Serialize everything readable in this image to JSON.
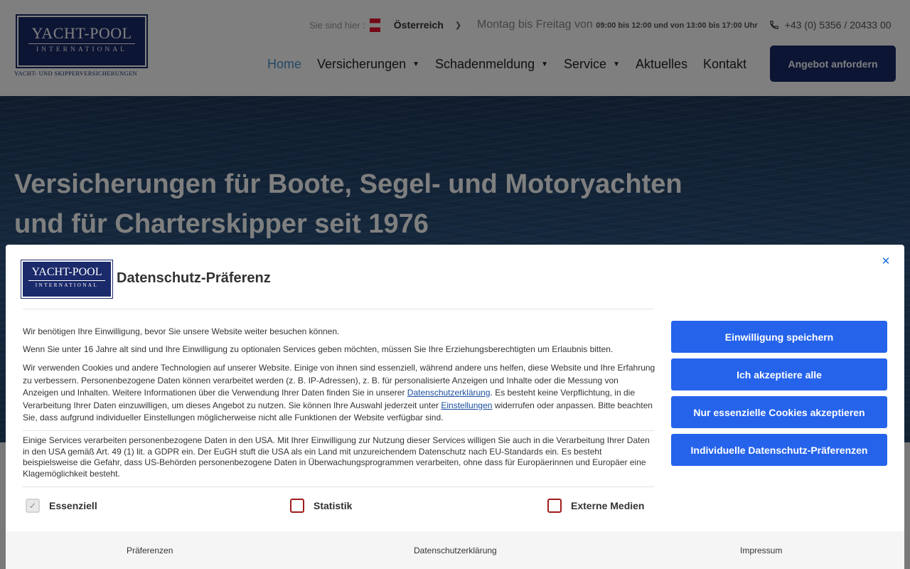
{
  "header": {
    "logo": {
      "main": "YACHT-POOL",
      "sub": "INTERNATIONAL",
      "tagline": "YACHT- UND SKIPPERVERSICHERUNGEN"
    },
    "location_label": "Sie sind hier :",
    "country": "Österreich",
    "hours_prefix": "Montag bis Freitag von",
    "hours_detail": "09:00 bis 12:00 und von 13:00 bis 17:00 Uhr",
    "phone": "+43 (0) 5356 / 20433 00",
    "nav": [
      {
        "label": "Home",
        "active": true,
        "dropdown": false
      },
      {
        "label": "Versicherungen",
        "active": false,
        "dropdown": true
      },
      {
        "label": "Schadenmeldung",
        "active": false,
        "dropdown": true
      },
      {
        "label": "Service",
        "active": false,
        "dropdown": true
      },
      {
        "label": "Aktuelles",
        "active": false,
        "dropdown": false
      },
      {
        "label": "Kontakt",
        "active": false,
        "dropdown": false
      }
    ],
    "cta_label": "Angebot anfordern"
  },
  "hero": {
    "title_line1": "Versicherungen für Boote, Segel- und Motoryachten",
    "title_line2": "und für Charterskipper seit 1976"
  },
  "dialog": {
    "logo": {
      "main": "YACHT-POOL",
      "sub": "INTERNATIONAL"
    },
    "title": "Datenschutz-Präferenz",
    "close_icon": "close-icon",
    "p1": "Wir benötigen Ihre Einwilligung, bevor Sie unsere Website weiter besuchen können.",
    "p2": "Wenn Sie unter 16 Jahre alt sind und Ihre Einwilligung zu optionalen Services geben möchten, müssen Sie Ihre Erziehungsberechtigten um Erlaubnis bitten.",
    "p3_a": "Wir verwenden Cookies und andere Technologien auf unserer Website. Einige von ihnen sind essenziell, während andere uns helfen, diese Website und Ihre Erfahrung zu verbessern. Personenbezogene Daten können verarbeitet werden (z. B. IP-Adressen), z. B. für personalisierte Anzeigen und Inhalte oder die Messung von Anzeigen und Inhalten. Weitere Informationen über die Verwendung Ihrer Daten finden Sie in unserer ",
    "p3_link1": "Datenschutzerklärung",
    "p3_b": ". Es besteht keine Verpflichtung, in die Verarbeitung Ihrer Daten einzuwilligen, um dieses Angebot zu nutzen. Sie können Ihre Auswahl jederzeit unter ",
    "p3_link2": "Einstellungen",
    "p3_c": " widerrufen oder anpassen. Bitte beachten Sie, dass aufgrund individueller Einstellungen möglicherweise nicht alle Funktionen der Website verfügbar sind.",
    "p4": "Einige Services verarbeiten personenbezogene Daten in den USA. Mit Ihrer Einwilligung zur Nutzung dieser Services willigen Sie auch in die Verarbeitung Ihrer Daten in den USA gemäß Art. 49 (1) lit. a GDPR ein. Der EuGH stuft die USA als ein Land mit unzureichendem Datenschutz nach EU-Standards ein. Es besteht beispielsweise die Gefahr, dass US-Behörden personenbezogene Daten in Überwachungsprogrammen verarbeiten, ohne dass für Europäerinnen und Europäer eine Klagemöglichkeit besteht.",
    "checkboxes": [
      {
        "label": "Essenziell",
        "checked": true,
        "disabled": true
      },
      {
        "label": "Statistik",
        "checked": false,
        "disabled": false
      },
      {
        "label": "Externe Medien",
        "checked": false,
        "disabled": false
      }
    ],
    "buttons": {
      "save": "Einwilligung speichern",
      "accept_all": "Ich akzeptiere alle",
      "essential_only": "Nur essenzielle Cookies akzeptieren",
      "individual": "Individuelle Datenschutz-Präferenzen"
    },
    "footer": {
      "preferences": "Präferenzen",
      "privacy": "Datenschutzerklärung",
      "imprint": "Impressum"
    },
    "colors": {
      "primary_button": "#2563eb",
      "brand_navy": "#1b2a6b",
      "checkbox_border": "#a01c1c"
    }
  }
}
